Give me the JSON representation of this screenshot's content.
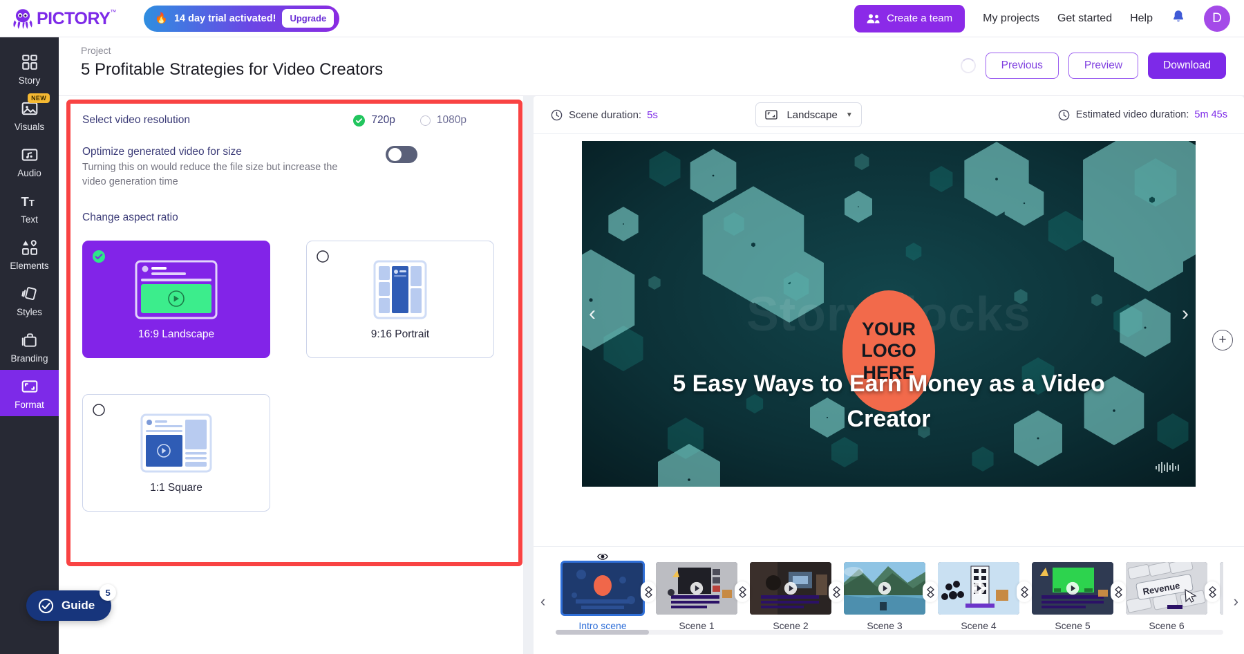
{
  "brand": {
    "name": "PICTORY",
    "tm": "™",
    "accent": "#7d2ae8"
  },
  "topbar": {
    "trial_text": "14 day trial activated!",
    "upgrade_label": "Upgrade",
    "create_team_label": "Create a team",
    "links": [
      "My projects",
      "Get started",
      "Help"
    ],
    "avatar_initial": "D"
  },
  "project": {
    "kicker": "Project",
    "title": "5 Profitable Strategies for Video Creators",
    "actions": {
      "previous": "Previous",
      "preview": "Preview",
      "download": "Download"
    }
  },
  "sidebar": {
    "items": [
      {
        "label": "Story",
        "icon": "grid-icon",
        "active": false,
        "badge": null
      },
      {
        "label": "Visuals",
        "icon": "image-icon",
        "active": false,
        "badge": "NEW"
      },
      {
        "label": "Audio",
        "icon": "music-icon",
        "active": false,
        "badge": null
      },
      {
        "label": "Text",
        "icon": "text-icon",
        "active": false,
        "badge": null
      },
      {
        "label": "Elements",
        "icon": "shapes-icon",
        "active": false,
        "badge": null
      },
      {
        "label": "Styles",
        "icon": "styles-icon",
        "active": false,
        "badge": null
      },
      {
        "label": "Branding",
        "icon": "briefcase-icon",
        "active": false,
        "badge": null
      },
      {
        "label": "Format",
        "icon": "format-icon",
        "active": true,
        "badge": null
      }
    ]
  },
  "format_panel": {
    "resolution_label": "Select video resolution",
    "resolutions": [
      {
        "label": "720p",
        "selected": true
      },
      {
        "label": "1080p",
        "selected": false
      }
    ],
    "optimize_title": "Optimize generated video for size",
    "optimize_desc": "Turning this on would reduce the file size but increase the video generation time",
    "optimize_enabled": false,
    "aspect_label": "Change aspect ratio",
    "aspect_cards": [
      {
        "name": "16:9 Landscape",
        "selected": true
      },
      {
        "name": "9:16 Portrait",
        "selected": false
      },
      {
        "name": "1:1 Square",
        "selected": false
      }
    ]
  },
  "editor": {
    "scene_duration_label": "Scene duration:",
    "scene_duration_value": "5s",
    "aspect_select_value": "Landscape",
    "estimated_label": "Estimated video duration:",
    "estimated_value": "5m 45s",
    "toolbar": {
      "undo": "undo-icon",
      "redo": "redo-icon",
      "play": "play-icon",
      "captions": "closed-captions-icon",
      "voiceover": "microphone-icon",
      "trim": "scissors-icon",
      "settings": "gear-icon",
      "delete": "trash-icon"
    },
    "add_scene_label": "+",
    "preview": {
      "logo_lines": [
        "YOUR",
        "LOGO",
        "HERE"
      ],
      "title": "5 Easy Ways to Earn Money as a Video Creator",
      "watermark": "Storyblocks",
      "logo_bg": "#f26a4b",
      "bg_color": "#0b2b2f"
    }
  },
  "timeline": {
    "scenes": [
      {
        "label": "Intro scene",
        "selected": true
      },
      {
        "label": "Scene 1",
        "selected": false
      },
      {
        "label": "Scene 2",
        "selected": false
      },
      {
        "label": "Scene 3",
        "selected": false
      },
      {
        "label": "Scene 4",
        "selected": false
      },
      {
        "label": "Scene 5",
        "selected": false
      },
      {
        "label": "Scene 6",
        "selected": false
      }
    ],
    "prev_arrow": "‹",
    "next_arrow": "›"
  },
  "guide": {
    "label": "Guide",
    "count": "5"
  }
}
